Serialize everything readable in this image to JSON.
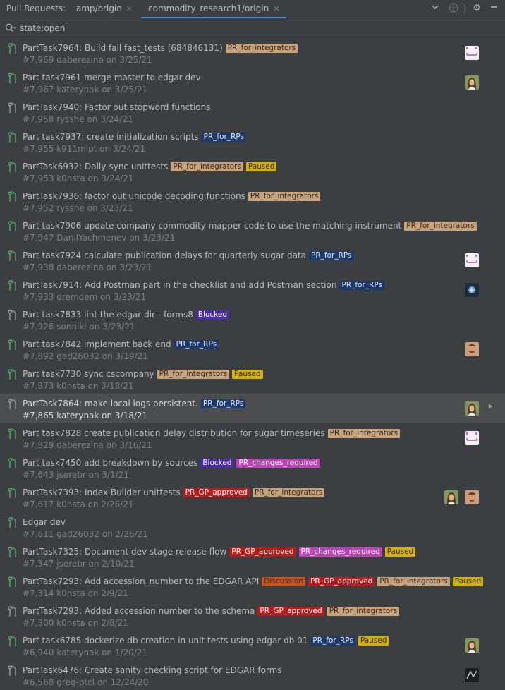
{
  "header": {
    "title": "Pull Requests:",
    "tabs": [
      {
        "label": "amp/origin",
        "active": false
      },
      {
        "label": "commodity_research1/origin",
        "active": true
      }
    ]
  },
  "search": {
    "query": "state:open"
  },
  "label_colors": {
    "PR_for_integrators": {
      "bg": "#c9a27a",
      "fg": "#2b2b2b"
    },
    "PR_for_RPs": {
      "bg": "#1d3a6e",
      "fg": "#e6e6e6"
    },
    "Paused": {
      "bg": "#d6b200",
      "fg": "#2b2b2b"
    },
    "Blocked": {
      "bg": "#4a2bb0",
      "fg": "#ffffff"
    },
    "PR_changes_required": {
      "bg": "#c042b8",
      "fg": "#ffffff"
    },
    "PR_GP_approved": {
      "bg": "#b71c1c",
      "fg": "#ffffff"
    },
    "Discussion": {
      "bg": "#c8541c",
      "fg": "#2b2b2b"
    }
  },
  "pull_requests": [
    {
      "title": "PartTask7964: Build fail fast_tests (684846131)",
      "meta": "#7,969 daberezina on 3/25/21",
      "labels": [
        "PR_for_integrators"
      ],
      "state": "open",
      "avatars": [
        "avatar-pink"
      ]
    },
    {
      "title": "Part task7961 merge master to edgar dev",
      "meta": "#7,967 katerynak on 3/25/21",
      "labels": [],
      "state": "open",
      "avatars": [
        "avatar-woman"
      ]
    },
    {
      "title": "PartTask7940: Factor out stopword functions",
      "meta": "#7,958 rysshe on 3/24/21",
      "labels": [],
      "state": "draft",
      "avatars": []
    },
    {
      "title": "Part task7937: create initialization scripts",
      "meta": "#7,955 k911mipt on 3/24/21",
      "labels": [
        "PR_for_RPs"
      ],
      "state": "open",
      "avatars": []
    },
    {
      "title": "PartTask6932: Daily-sync unittests",
      "meta": "#7,953 k0nsta on 3/24/21",
      "labels": [
        "PR_for_integrators",
        "Paused"
      ],
      "state": "open",
      "avatars": []
    },
    {
      "title": "PartTask7936: factor out unicode decoding functions",
      "meta": "#7,952 rysshe on 3/23/21",
      "labels": [
        "PR_for_integrators"
      ],
      "state": "open",
      "avatars": []
    },
    {
      "title": "Part task7906 update company commodity mapper code to use the matching instrument",
      "meta": "#7,947 DanilYachmenev on 3/23/21",
      "labels": [
        "PR_for_integrators"
      ],
      "state": "open",
      "avatars": []
    },
    {
      "title": "Part task7924 calculate publication delays for quarterly sugar data",
      "meta": "#7,938 daberezina on 3/23/21",
      "labels": [
        "PR_for_RPs"
      ],
      "state": "open",
      "avatars": [
        "avatar-pink"
      ]
    },
    {
      "title": "PartTask7914: Add Postman part in the checklist and add Postman section",
      "meta": "#7,933 dremdem on 3/23/21",
      "labels": [
        "PR_for_RPs"
      ],
      "state": "open",
      "avatars": [
        "avatar-blue"
      ]
    },
    {
      "title": "Part task7833 lint the edgar dir - forms8",
      "meta": "#7,926 sonniki on 3/23/21",
      "labels": [
        "Blocked"
      ],
      "state": "draft",
      "avatars": []
    },
    {
      "title": "Part task7842 implement back end",
      "meta": "#7,892 gad26032 on 3/19/21",
      "labels": [
        "PR_for_RPs"
      ],
      "state": "open",
      "avatars": [
        "avatar-man"
      ]
    },
    {
      "title": "Part task7730 sync cscompany",
      "meta": "#7,873 k0nsta on 3/18/21",
      "labels": [
        "PR_for_integrators",
        "Paused"
      ],
      "state": "open",
      "avatars": []
    },
    {
      "title": "PartTask7864: make local logs persistent.",
      "meta": "#7,865 katerynak on 3/18/21",
      "labels": [
        "PR_for_RPs"
      ],
      "state": "draft",
      "avatars": [
        "avatar-woman"
      ],
      "selected": true
    },
    {
      "title": "Part task7828 create publication delay distribution for sugar timeseries",
      "meta": "#7,829 daberezina on 3/16/21",
      "labels": [
        "PR_for_integrators"
      ],
      "state": "open",
      "avatars": [
        "avatar-pink"
      ]
    },
    {
      "title": "Part task7450 add breakdown by sources",
      "meta": "#7,643 jserebr on 3/1/21",
      "labels": [
        "Blocked",
        "PR_changes_required"
      ],
      "state": "open",
      "avatars": []
    },
    {
      "title": "PartTask7393: Index Builder unittests",
      "meta": "#7,617 k0nsta on 2/26/21",
      "labels": [
        "PR_GP_approved",
        "PR_for_integrators"
      ],
      "state": "open",
      "avatars": [
        "avatar-woman",
        "avatar-man"
      ]
    },
    {
      "title": "Edgar dev",
      "meta": "#7,611 gad26032 on 2/26/21",
      "labels": [],
      "state": "open",
      "avatars": []
    },
    {
      "title": "PartTask7325: Document dev stage release flow",
      "meta": "#7,347 jserebr on 2/10/21",
      "labels": [
        "PR_GP_approved",
        "PR_changes_required",
        "Paused"
      ],
      "state": "open",
      "avatars": []
    },
    {
      "title": "PartTask7293: Add accession_number to the EDGAR API",
      "meta": "#7,314 k0nsta on 2/9/21",
      "labels": [
        "Discussion",
        "PR_GP_approved",
        "PR_for_integrators",
        "Paused"
      ],
      "state": "open",
      "avatars": []
    },
    {
      "title": "PartTask7293: Added accession number to the schema",
      "meta": "#7,300 k0nsta on 2/8/21",
      "labels": [
        "PR_GP_approved",
        "PR_for_integrators"
      ],
      "state": "draft",
      "avatars": []
    },
    {
      "title": "Part task6785 dockerize db creation in unit tests using edgar db 01",
      "meta": "#6,940 katerynak on 1/20/21",
      "labels": [
        "PR_for_RPs",
        "Paused"
      ],
      "state": "open",
      "avatars": [
        "avatar-woman"
      ]
    },
    {
      "title": "PartTask6476: Create sanity checking script for EDGAR forms",
      "meta": "#6,568 greg-ptcl on 12/24/20",
      "labels": [],
      "state": "draft",
      "avatars": [
        "avatar-dark"
      ]
    }
  ]
}
